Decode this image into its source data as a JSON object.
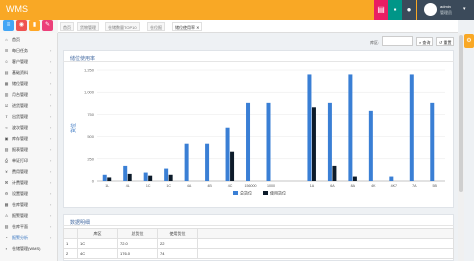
{
  "app": {
    "logo": "WMS",
    "user_name": "admin",
    "user_role": "管理员",
    "accent": "#f9a825"
  },
  "header_buttons": [
    {
      "icon": "file-icon",
      "color": "#e91e63",
      "glyph": "▤"
    },
    {
      "icon": "save-icon",
      "color": "#009688",
      "glyph": "▪"
    },
    {
      "icon": "lock-icon",
      "color": "#3b4a5a",
      "glyph": "🔒"
    }
  ],
  "toolbar_icons": [
    {
      "icon": "menu-icon",
      "color": "#42a5f5",
      "glyph": "≡"
    },
    {
      "icon": "user-icon",
      "color": "#ef5350",
      "glyph": "◉"
    },
    {
      "icon": "clipboard-icon",
      "color": "#ffa726",
      "glyph": "▮"
    },
    {
      "icon": "wrench-icon",
      "color": "#ec407a",
      "glyph": "✎"
    }
  ],
  "sidebar": [
    {
      "label": "首页",
      "icon": "home-icon",
      "glyph": "⌂",
      "caret": ""
    },
    {
      "label": "每日任务",
      "icon": "task-icon",
      "glyph": "☰",
      "caret": "‹"
    },
    {
      "label": "客户管理",
      "icon": "customer-icon",
      "glyph": "☺",
      "caret": "‹"
    },
    {
      "label": "基础资料",
      "icon": "database-icon",
      "glyph": "▤",
      "caret": "‹"
    },
    {
      "label": "储位管理",
      "icon": "storage-icon",
      "glyph": "▦",
      "caret": "‹"
    },
    {
      "label": "月台管理",
      "icon": "dock-icon",
      "glyph": "▥",
      "caret": "‹"
    },
    {
      "label": "进货管理",
      "icon": "inbound-icon",
      "glyph": "☑",
      "caret": "‹"
    },
    {
      "label": "出货管理",
      "icon": "outbound-icon",
      "glyph": "⇪",
      "caret": "‹"
    },
    {
      "label": "波次管理",
      "icon": "wave-icon",
      "glyph": "≈",
      "caret": "‹"
    },
    {
      "label": "库存管理",
      "icon": "stock-icon",
      "glyph": "▣",
      "caret": "‹"
    },
    {
      "label": "报表管理",
      "icon": "report-icon",
      "glyph": "▨",
      "caret": "‹"
    },
    {
      "label": "单证打印",
      "icon": "print-icon",
      "glyph": "⎙",
      "caret": "‹"
    },
    {
      "label": "费用管理",
      "icon": "fee-icon",
      "glyph": "¥",
      "caret": "‹"
    },
    {
      "label": "计费管理",
      "icon": "billing-icon",
      "glyph": "⌘",
      "caret": "‹"
    },
    {
      "label": "设置管理",
      "icon": "settings-icon",
      "glyph": "⚙",
      "caret": "‹"
    },
    {
      "label": "仓库管理",
      "icon": "warehouse-icon",
      "glyph": "▩",
      "caret": "‹"
    },
    {
      "label": "报警管理",
      "icon": "alarm-icon",
      "glyph": "⚠",
      "caret": "‹"
    },
    {
      "label": "仓库平面",
      "icon": "map-icon",
      "glyph": "▧",
      "caret": "‹"
    },
    {
      "label": "报警分析",
      "icon": "chart-icon",
      "glyph": "◔",
      "caret": "‹"
    },
    {
      "label": "仓储管理(WMS)",
      "icon": "wms-icon",
      "glyph": "▪",
      "caret": ""
    }
  ],
  "tabs": [
    {
      "label": "首页"
    },
    {
      "label": "货物管理"
    },
    {
      "label": "仓储数量TOP10"
    },
    {
      "label": "仓位报"
    },
    {
      "label": "储位使用率",
      "active": true
    }
  ],
  "filter": {
    "label": "库区:",
    "value": ""
  },
  "buttons": {
    "search": "⌕ 查询",
    "reset": "↺ 重置"
  },
  "chart_panel": {
    "title": "储位使用率"
  },
  "table_panel": {
    "title": "数据明细"
  },
  "chart_data": {
    "type": "bar",
    "ylabel": "货位",
    "ylim": [
      0,
      1250
    ],
    "yticks": [
      0,
      250,
      500,
      750,
      "1,000",
      "1,250"
    ],
    "categories": [
      "1L",
      "4L",
      "1C",
      "1C",
      "4A",
      "4B",
      "4C",
      "156000",
      "1000",
      "1A",
      "6A",
      "8A",
      "4K",
      "4K7",
      "7A",
      "5B"
    ],
    "series": [
      {
        "name": "总货位",
        "color": "#3a7fd5",
        "values": [
          70,
          170,
          95,
          140,
          420,
          420,
          600,
          880,
          880,
          0,
          1200,
          880,
          1200,
          790,
          50,
          1200,
          880
        ]
      },
      {
        "name": "使用货位",
        "color": "#0d1b2a",
        "values": [
          40,
          80,
          60,
          70,
          0,
          0,
          330,
          0,
          0,
          0,
          830,
          170,
          50,
          0,
          0,
          0,
          0
        ]
      }
    ],
    "legend": "bottom-center"
  },
  "table": {
    "headers": [
      "库区",
      "总货位",
      "使用货位"
    ],
    "rows": [
      [
        "1C",
        "72.0",
        "22"
      ],
      [
        "4C",
        "176.0",
        "74"
      ]
    ]
  }
}
